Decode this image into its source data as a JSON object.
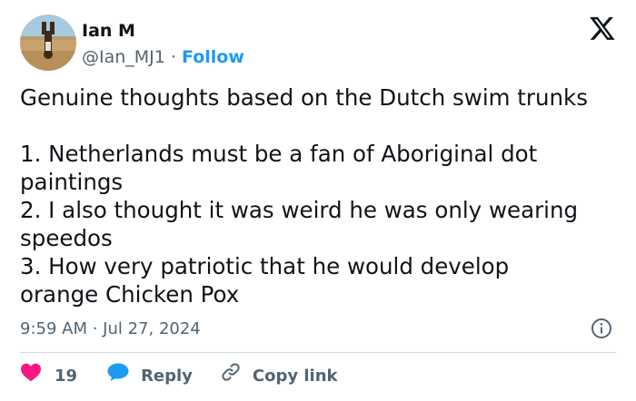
{
  "author": {
    "display_name": "Ian M",
    "handle": "@Ian_MJ1",
    "separator": "·",
    "follow_label": "Follow"
  },
  "tweet": {
    "text": "Genuine thoughts based on the Dutch swim trunks\n\n1. Netherlands must be a fan of Aboriginal dot\npaintings\n2. I also thought it was weird he was only wearing\nspeedos\n3. How very patriotic that he would develop\norange Chicken Pox",
    "timestamp": "9:59 AM · Jul 27, 2024"
  },
  "actions": {
    "like_count": "19",
    "reply_label": "Reply",
    "copy_label": "Copy link"
  },
  "colors": {
    "accent": "#1d9bf0",
    "like": "#f91880",
    "text_secondary": "#536471"
  },
  "icons": {
    "logo": "x-logo-icon",
    "info": "info-icon",
    "like": "heart-icon",
    "reply": "speech-bubble-icon",
    "copy": "link-icon"
  }
}
